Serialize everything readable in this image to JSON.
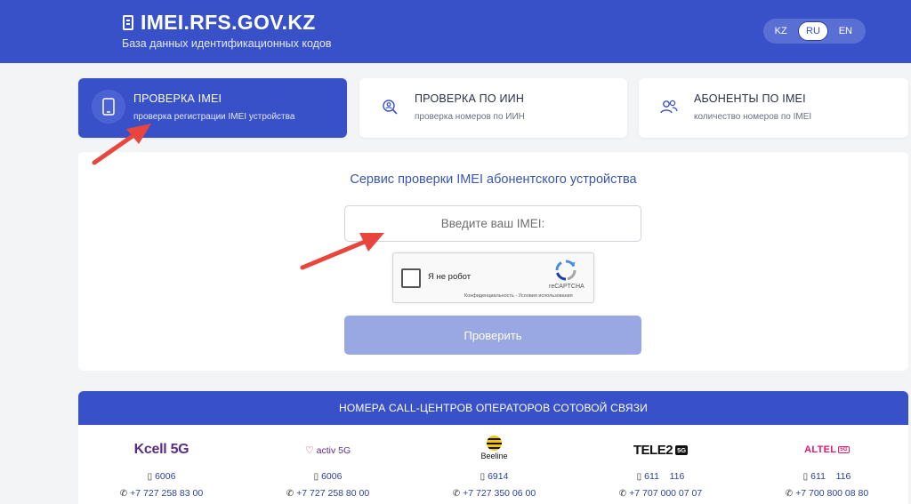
{
  "header": {
    "title": "IMEI.RFS.GOV.KZ",
    "subtitle": "База данных идентификационных кодов",
    "background": "#3851c9",
    "languages": [
      {
        "code": "KZ",
        "active": false
      },
      {
        "code": "RU",
        "active": true
      },
      {
        "code": "EN",
        "active": false
      }
    ]
  },
  "tabs": [
    {
      "title": "ПРОВЕРКА IMEI",
      "subtitle": "проверка регистрации IMEI устройства",
      "icon": "phone-icon",
      "active": true
    },
    {
      "title": "ПРОВЕРКА ПО ИИН",
      "subtitle": "проверка номеров по ИИН",
      "icon": "id-search-icon",
      "active": false
    },
    {
      "title": "АБОНЕНТЫ ПО IMEI",
      "subtitle": "количество номеров по IMEI",
      "icon": "users-icon",
      "active": false
    }
  ],
  "form": {
    "title": "Сервис проверки IMEI абонентского устройства",
    "imei_placeholder": "Введите ваш IMEI:",
    "recaptcha_label": "Я не робот",
    "recaptcha_brand": "reCAPTCHA",
    "recaptcha_links": "Конфиденциальность - Условия использования",
    "submit_label": "Проверить"
  },
  "callcenters": {
    "title": "НОМЕРА CALL-ЦЕНТРОВ ОПЕРАТОРОВ СОТОВОЙ СВЯЗИ",
    "operators": [
      {
        "name": "Kcell",
        "badge": "5G",
        "short": "6006",
        "phone": "+7 727 258 83 00"
      },
      {
        "name": "activ",
        "badge": "5G",
        "short": "6006",
        "phone": "+7 727 258 80 00"
      },
      {
        "name": "Beeline",
        "badge": "",
        "short": "6914",
        "phone": "+7 727 350 06 00"
      },
      {
        "name": "TELE2",
        "badge": "5G",
        "short": "611    116",
        "phone": "+7 707 000 07 07"
      },
      {
        "name": "ALTEL",
        "badge": "5G",
        "short": "611    116",
        "phone": "+7 700 800 08 80"
      }
    ]
  },
  "colors": {
    "accent": "#3851c9",
    "button_disabled": "#99a8e3",
    "annotation_arrow": "#e8453c"
  }
}
